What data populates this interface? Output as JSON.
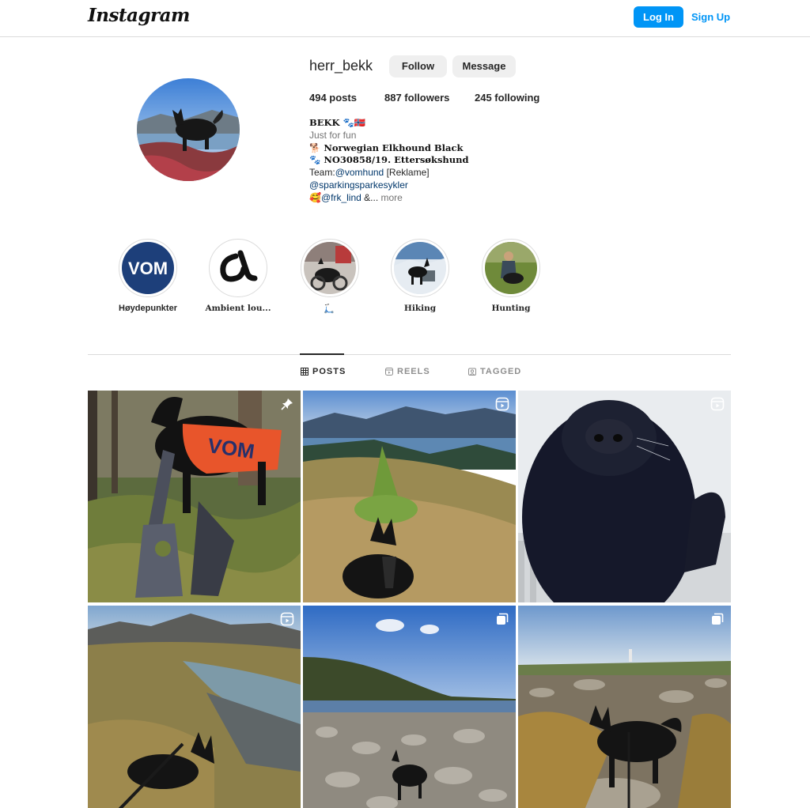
{
  "brand": {
    "logo_text": "Instagram"
  },
  "nav": {
    "login_label": "Log In",
    "signup_label": "Sign Up"
  },
  "profile": {
    "username": "herr_bekk",
    "follow_label": "Follow",
    "message_label": "Message",
    "stats": {
      "posts": "494 posts",
      "followers": "887 followers",
      "following": "245 following"
    },
    "bio": {
      "name": "BEKK 🐾🇳🇴",
      "line1": "Just for fun",
      "line2": "🐕 Norwegian Elkhound Black",
      "line3": "🐾 NO30858/19. Ettersøkshund",
      "line4_prefix": "Team:",
      "line4_mention": "@vomhund",
      "line4_suffix": " [Reklame]",
      "line5_mention": "@sparkingsparkesykler",
      "line6_emoji": "🥰",
      "line6_mention": "@frk_lind",
      "line6_suffix": " &...",
      "more_label": " more"
    }
  },
  "highlights": [
    {
      "label": "Høydepunkter",
      "cover_text": "VOM"
    },
    {
      "label": "Ambient lou..."
    },
    {
      "label": "🛴"
    },
    {
      "label": "Hiking"
    },
    {
      "label": "Hunting"
    }
  ],
  "tabs": [
    {
      "label": "POSTS",
      "icon": "grid-icon",
      "active": true
    },
    {
      "label": "REELS",
      "icon": "reels-icon",
      "active": false
    },
    {
      "label": "TAGGED",
      "icon": "tagged-icon",
      "active": false
    }
  ],
  "posts": [
    {
      "description": "pinned post",
      "badge": "pin-icon",
      "overlay_text": "VOM"
    },
    {
      "description": "reel",
      "badge": "reel-icon"
    },
    {
      "description": "reel",
      "badge": "reel-icon"
    },
    {
      "description": "reel",
      "badge": "reel-icon"
    },
    {
      "description": "carousel",
      "badge": "carousel-icon"
    },
    {
      "description": "carousel",
      "badge": "carousel-icon"
    }
  ],
  "colors": {
    "accent": "#0095f6",
    "text": "#262626",
    "muted": "#737373",
    "border": "#dbdbdb",
    "link": "#00376b"
  }
}
